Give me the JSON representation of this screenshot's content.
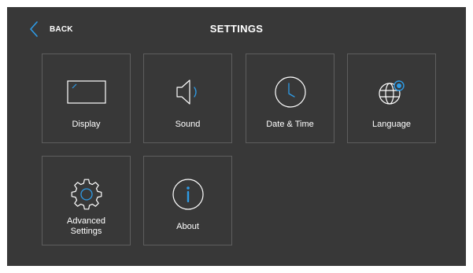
{
  "header": {
    "back_label": "BACK",
    "title": "SETTINGS"
  },
  "tiles": [
    {
      "label": "Display",
      "icon": "display-icon"
    },
    {
      "label": "Sound",
      "icon": "speaker-icon"
    },
    {
      "label": "Date & Time",
      "icon": "clock-icon"
    },
    {
      "label": "Language",
      "icon": "globe-icon"
    },
    {
      "label": "Advanced\nSettings",
      "icon": "gear-icon"
    },
    {
      "label": "About",
      "icon": "info-icon"
    }
  ],
  "colors": {
    "background": "#383838",
    "accent": "#2e9be6",
    "tile_border": "#5e5e5e",
    "text": "#ffffff"
  }
}
